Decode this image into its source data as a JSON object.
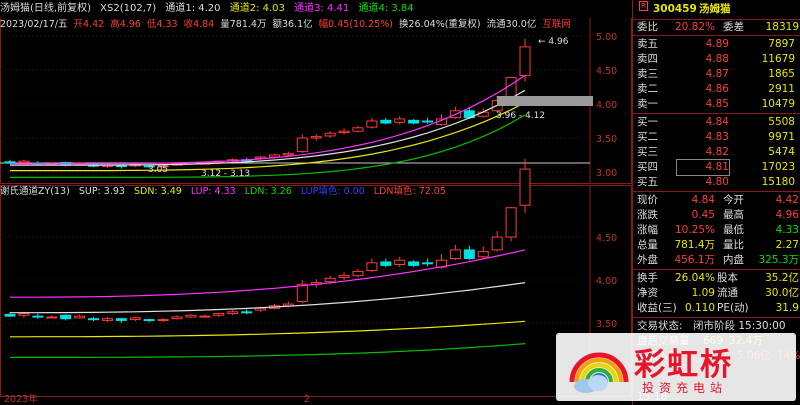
{
  "top_bar": {
    "title": "汤姆猫(日线,前复权)",
    "xs2": "XS2(102,7)",
    "t1": "通道1: 4.20",
    "t2": "通道2: 4.03",
    "t3": "通道3: 4.41",
    "t4": "通道4: 3.84"
  },
  "info_bar": {
    "date": "2023/02/17/五",
    "open": "开4.42",
    "high": "高4.96",
    "low": "低4.33",
    "close": "收4.84",
    "volume": "量781.4万",
    "amount": "额36.1亿",
    "change": "幅0.45(10.25%)",
    "turnover": "换26.04%(重复权)",
    "float": "流通30.0亿",
    "link": "互联网"
  },
  "main_chart": {
    "y_ticks": [
      "5.00",
      "4.50",
      "4.00",
      "3.50",
      "3.00"
    ],
    "high_label": "4.96",
    "range_label": "3.96 - 4.12",
    "low_label1": "3.05",
    "low_label2": "3.12 - 3.13"
  },
  "sub_bar": {
    "title": "谢氏通道ZY(13)",
    "sup": "SUP: 3.93",
    "sdn": "SDN: 3.49",
    "lup": "LUP: 4.33",
    "ldn": "LDN: 3.26",
    "tx": "LUP填色: 0.00",
    "ldn2": "LDN填色: 72.05"
  },
  "sub_chart": {
    "y_ticks": [
      "4.50",
      "4.00",
      "3.50"
    ],
    "x_labels": [
      "2023年",
      "2"
    ]
  },
  "quote": {
    "badge": "R",
    "code": "300459",
    "name": "汤姆猫",
    "weibi_label": "委比",
    "weibi_value": "20.82%",
    "weicha_label": "委差",
    "weicha_value": "18319",
    "asks": [
      {
        "label": "卖五",
        "price": "4.89",
        "vol": "7897"
      },
      {
        "label": "卖四",
        "price": "4.88",
        "vol": "11679"
      },
      {
        "label": "卖三",
        "price": "4.87",
        "vol": "1865"
      },
      {
        "label": "卖二",
        "price": "4.86",
        "vol": "2911"
      },
      {
        "label": "卖一",
        "price": "4.85",
        "vol": "10479"
      }
    ],
    "bids": [
      {
        "label": "买一",
        "price": "4.84",
        "vol": "5508"
      },
      {
        "label": "买二",
        "price": "4.83",
        "vol": "9971"
      },
      {
        "label": "买三",
        "price": "4.82",
        "vol": "5474"
      },
      {
        "label": "买四",
        "price": "4.81",
        "vol": "17023"
      },
      {
        "label": "买五",
        "price": "4.80",
        "vol": "15180"
      }
    ],
    "stats": [
      {
        "l1": "现价",
        "v1": "4.84",
        "l2": "今开",
        "v2": "4.42"
      },
      {
        "l1": "涨跌",
        "v1": "0.45",
        "l2": "最高",
        "v2": "4.96"
      },
      {
        "l1": "涨幅",
        "v1": "10.25%",
        "l2": "最低",
        "v2": "4.33"
      },
      {
        "l1": "总量",
        "v1": "781.4万",
        "l2": "量比",
        "v2": "2.27"
      },
      {
        "l1": "外盘",
        "v1": "456.1万",
        "l2": "内盘",
        "v2": "325.3万"
      }
    ],
    "stats2": [
      {
        "l1": "换手",
        "v1": "26.04%",
        "l2": "股本",
        "v2": "35.2亿"
      },
      {
        "l1": "净资",
        "v1": "1.09",
        "l2": "流通",
        "v2": "30.0亿"
      },
      {
        "l1": "收益(三)",
        "v1": "0.110",
        "l2": "PE(动)",
        "v2": "31.9"
      }
    ],
    "status_label": "交易状态:",
    "status_value": "闭市阶段 15:30:00",
    "after_label": "盘后交易量",
    "after_value": "669",
    "after_amount": "32.4万",
    "inflow_label": "净流入额",
    "inflow_value": "5.06亿",
    "inflow_pct": "14%",
    "bottom_time": "15:18"
  },
  "watermark": {
    "title": "彩虹桥",
    "subtitle": "投资充电站"
  },
  "colors": {
    "up": "#ff3b3b",
    "down": "#00e0e0",
    "yellow": "#e8e800",
    "magenta": "#ff30ff",
    "green": "#00c000",
    "white": "#e0e0e0",
    "border": "#8a1a1a"
  }
}
